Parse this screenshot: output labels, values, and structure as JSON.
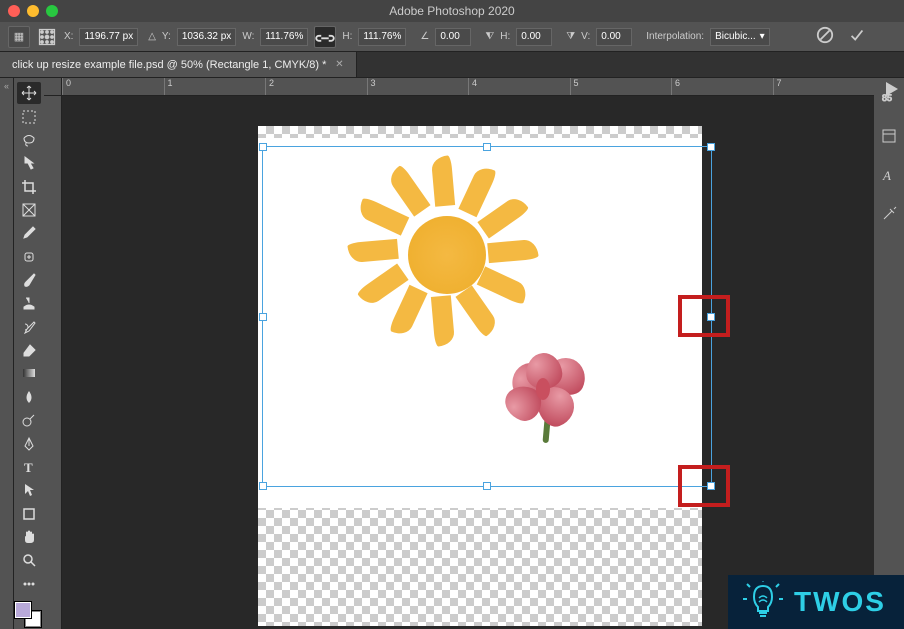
{
  "app": {
    "title": "Adobe Photoshop 2020"
  },
  "options": {
    "x_label": "X:",
    "x_value": "1196.77 px",
    "y_label": "Y:",
    "y_value": "1036.32 px",
    "w_label": "W:",
    "w_value": "111.76%",
    "h_label": "H:",
    "h_value": "111.76%",
    "angle_label": "∠",
    "angle_value": "0.00",
    "h_skew_label": "H:",
    "h_skew_value": "0.00",
    "v_skew_label": "V:",
    "v_skew_value": "0.00",
    "interp_label": "Interpolation:",
    "interp_value": "Bicubic..."
  },
  "tab": {
    "label": "click up resize example file.psd @ 50% (Rectangle 1, CMYK/8) *"
  },
  "ruler": {
    "marks": [
      "0",
      "1",
      "2",
      "3",
      "4",
      "5",
      "6",
      "7"
    ]
  },
  "tools": [
    {
      "name": "move-tool"
    },
    {
      "name": "marquee-tool"
    },
    {
      "name": "lasso-tool"
    },
    {
      "name": "quick-select-tool"
    },
    {
      "name": "crop-tool"
    },
    {
      "name": "frame-tool"
    },
    {
      "name": "eyedropper-tool"
    },
    {
      "name": "healing-brush-tool"
    },
    {
      "name": "brush-tool"
    },
    {
      "name": "clone-stamp-tool"
    },
    {
      "name": "history-brush-tool"
    },
    {
      "name": "eraser-tool"
    },
    {
      "name": "gradient-tool"
    },
    {
      "name": "blur-tool"
    },
    {
      "name": "dodge-tool"
    },
    {
      "name": "pen-tool"
    },
    {
      "name": "type-tool"
    },
    {
      "name": "path-select-tool"
    },
    {
      "name": "shape-tool"
    },
    {
      "name": "hand-tool"
    },
    {
      "name": "zoom-tool"
    },
    {
      "name": "edit-toolbar"
    }
  ],
  "colors": {
    "accent": "#4aa3df",
    "highlight": "#c41e1e",
    "fg_swatch": "#b8a9d9",
    "bg_swatch": "#ffffff"
  },
  "watermark": {
    "text": "TWOS"
  }
}
